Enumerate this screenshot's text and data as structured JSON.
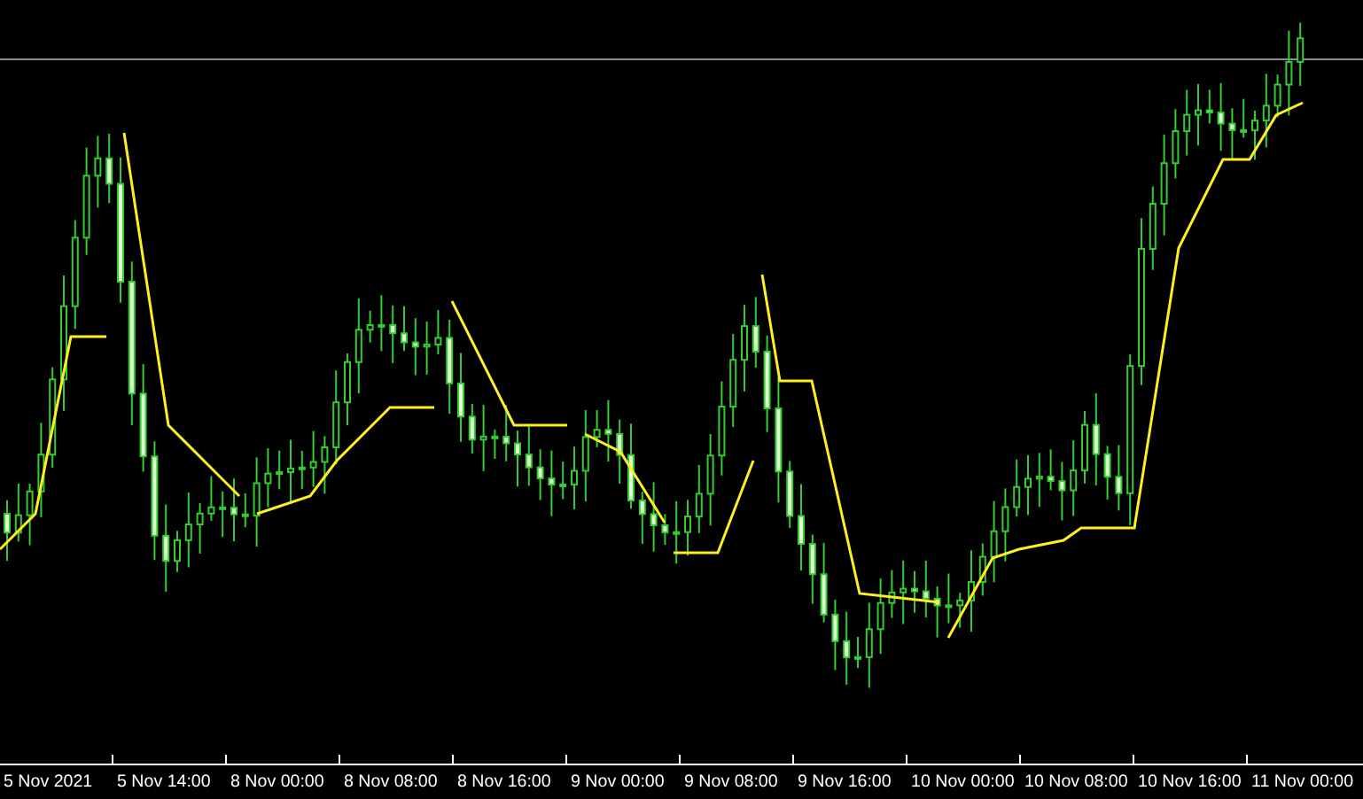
{
  "chart": {
    "x_axis_labels": [
      "5 Nov 2021",
      "5 Nov 14:00",
      "8 Nov 00:00",
      "8 Nov 08:00",
      "8 Nov 16:00",
      "9 Nov 00:00",
      "9 Nov 08:00",
      "9 Nov 16:00",
      "10 Nov 00:00",
      "10 Nov 08:00",
      "10 Nov 16:00",
      "11 Nov 00:00"
    ]
  }
}
